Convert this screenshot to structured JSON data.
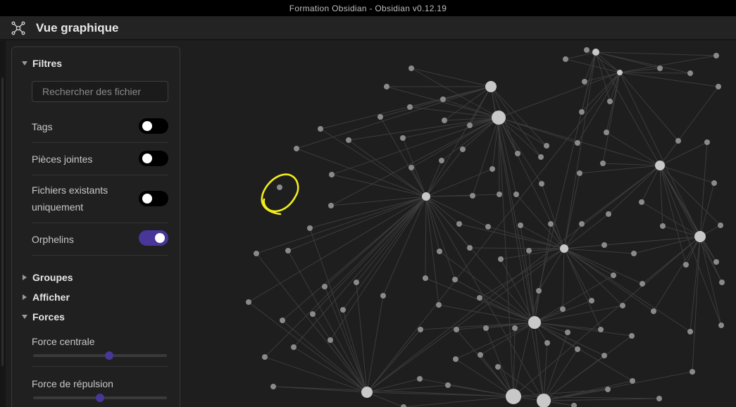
{
  "window": {
    "title": "Formation Obsidian - Obsidian v0.12.19"
  },
  "view": {
    "title": "Vue graphique",
    "icon": "graph-icon"
  },
  "panel": {
    "filters": {
      "heading": "Filtres",
      "search_placeholder": "Rechercher des fichier",
      "search_value": "",
      "toggles": [
        {
          "label": "Tags",
          "on": false
        },
        {
          "label": "Pièces jointes",
          "on": false
        },
        {
          "label": "Fichiers existants uniquement",
          "on": false
        },
        {
          "label": "Orphelins",
          "on": true
        }
      ]
    },
    "groups": {
      "heading": "Groupes"
    },
    "display": {
      "heading": "Afficher"
    },
    "forces": {
      "heading": "Forces",
      "sliders": [
        {
          "label": "Force centrale",
          "value": 0.57
        },
        {
          "label": "Force de répulsion",
          "value": 0.5
        }
      ]
    }
  },
  "colors": {
    "accent": "#483699",
    "annotation": "#f2ee1a",
    "node": "#8a8a8a",
    "hub": "#c8c8c8",
    "edge": "#3c3c3c"
  }
}
